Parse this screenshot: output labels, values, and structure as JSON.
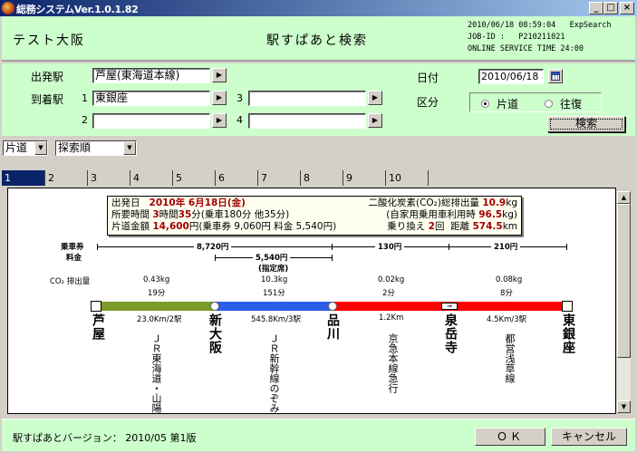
{
  "window": {
    "title": "総務システムVer.1.0.1.82",
    "controls": {
      "minimize": "_",
      "maximize": "□",
      "close": "×"
    }
  },
  "header": {
    "app_name": "テスト大阪",
    "screen_title": "駅すぱあと検索",
    "datetime_line": "2010/06/18 08:59:04   ExpSearch",
    "job_line": "JOB-ID :   P210211021",
    "service_line": "ONLINE SERVICE TIME 24:00"
  },
  "form": {
    "departure_label": "出発駅",
    "departure_value": "芦屋(東海道本線)",
    "arrival_label": "到着駅",
    "arrivals": [
      {
        "num": "1",
        "value": "東銀座"
      },
      {
        "num": "2",
        "value": ""
      },
      {
        "num": "3",
        "value": ""
      },
      {
        "num": "4",
        "value": ""
      }
    ],
    "date_label": "日付",
    "date_value": "2010/06/18",
    "type_label": "区分",
    "type_options": [
      {
        "label": "片道",
        "selected": true
      },
      {
        "label": "往復",
        "selected": false
      }
    ],
    "search_button": "検索",
    "picker_icon": "▶"
  },
  "filters": {
    "trip_type": "片道",
    "sort_order": "探索順"
  },
  "tabs": [
    "1",
    "2",
    "3",
    "4",
    "5",
    "6",
    "7",
    "8",
    "9",
    "10"
  ],
  "active_tab": "1",
  "summary": {
    "departure_label": "出発日",
    "departure_value": "2010年 6月18日(金)",
    "duration_label": "所要時間",
    "duration_hours": "3",
    "duration_h_unit": "時間",
    "duration_minutes": "35",
    "duration_rest": "分(乗車180分 他35分)",
    "fare_label": "片道金額",
    "fare_value": "14,600",
    "fare_rest": "円(乗車券 9,060円 料金 5,540円)",
    "co2_label": "二酸化炭素(CO₂)総排出量",
    "co2_value": "10.9",
    "co2_unit": "kg",
    "car_label": "(自家用乗用車利用時",
    "car_value": "96.5",
    "car_unit": "kg)",
    "transfer_label": "乗り換え",
    "transfer_value": "2",
    "transfer_unit": "回",
    "distance_label": "距離",
    "distance_value": "574.5",
    "distance_unit": "km"
  },
  "route": {
    "ticket_label": "乗車券",
    "fee_label": "料金",
    "co2_label": "CO₂ 排出量",
    "tickets": [
      "8,720円",
      "130円",
      "210円"
    ],
    "fee": "5,540円",
    "fee_note": "(指定席)",
    "segments": [
      {
        "co2": "0.43kg",
        "time": "19分",
        "distance": "23.0Km/2駅",
        "line": "ＪＲ東海道・山陽",
        "color": "#7a9a2a"
      },
      {
        "co2": "10.3kg",
        "time": "151分",
        "distance": "545.8Km/3駅",
        "line": "ＪＲ新幹線のぞみ",
        "color": "#2a5ee8"
      },
      {
        "co2": "0.02kg",
        "time": "2分",
        "distance": "1.2Km",
        "line": "京急本線急行",
        "color": "#ff0000"
      },
      {
        "co2": "0.08kg",
        "time": "8分",
        "distance": "4.5Km/3駅",
        "line": "都営浅草線",
        "color": "#ff0000"
      }
    ],
    "stations": [
      "芦屋",
      "新大阪",
      "品川",
      "泉岳寺",
      "東銀座"
    ],
    "transfer_symbol": "⇒"
  },
  "footer": {
    "version": "駅すぱあとバージョン： 2010/05 第1版",
    "ok_button": "ＯＫ",
    "cancel_button": "キャンセル"
  }
}
